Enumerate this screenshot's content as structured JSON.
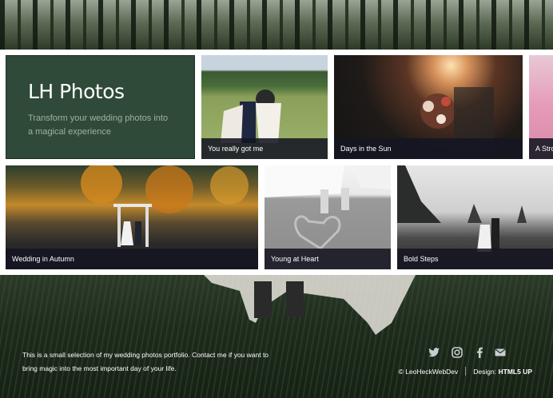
{
  "intro": {
    "title": "LH Photos",
    "subtitle": "Transform your wedding photos into a magical experience"
  },
  "gallery": {
    "items": [
      {
        "caption": "You really got me"
      },
      {
        "caption": "Days in the Sun"
      },
      {
        "caption": "A Stro"
      },
      {
        "caption": "Wedding in Autumn"
      },
      {
        "caption": "Young at Heart"
      },
      {
        "caption": "Bold Steps"
      }
    ]
  },
  "footer": {
    "text": "This is a small selection of my wedding photos portfolio. Contact me if you want to bring magic into the most important day of your life.",
    "social": [
      "twitter-icon",
      "instagram-icon",
      "facebook-icon",
      "envelope-icon"
    ],
    "copyright": "© LeoHeckWebDev",
    "design_label": "Design:",
    "design_name": "HTML5 UP"
  },
  "colors": {
    "intro_bg": "#2f4a38",
    "caption_bg": "#14162299",
    "footer_text": "#ffffff"
  }
}
